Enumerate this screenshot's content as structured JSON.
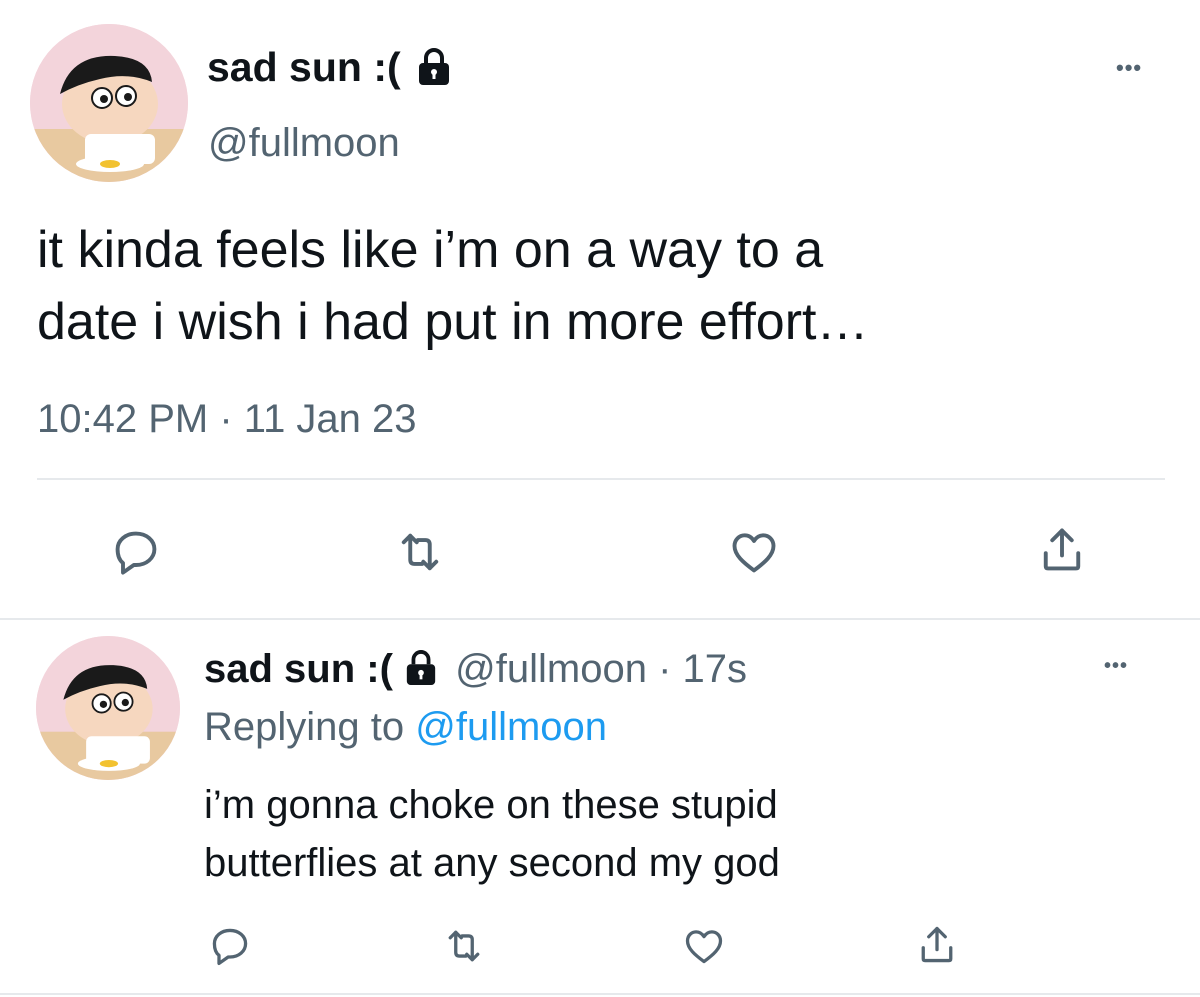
{
  "main_tweet": {
    "display_name": "sad sun :(",
    "handle": "@fullmoon",
    "text_line1": "it kinda feels like i’m on a way to a",
    "text_line2": "date i wish i had put in more effort…",
    "time": "10:42 PM",
    "separator": "·",
    "date": "11 Jan 23",
    "more_label": "•••"
  },
  "reply_tweet": {
    "display_name": "sad sun :(",
    "handle": "@fullmoon",
    "separator": "·",
    "age": "17s",
    "replying_prefix": "Replying to",
    "replying_handle": "@fullmoon",
    "text_line1": "i’m gonna choke on these stupid",
    "text_line2": "butterflies at any second my god",
    "more_label": "•••"
  },
  "icons": {
    "lock": "lock-icon",
    "reply": "reply-icon",
    "retweet": "retweet-icon",
    "like": "heart-icon",
    "share": "share-icon",
    "more": "more-icon"
  },
  "colors": {
    "text": "#0f1419",
    "secondary": "#536471",
    "link": "#1d9bf0",
    "divider": "#e6e9ec",
    "icon": "#536471"
  }
}
